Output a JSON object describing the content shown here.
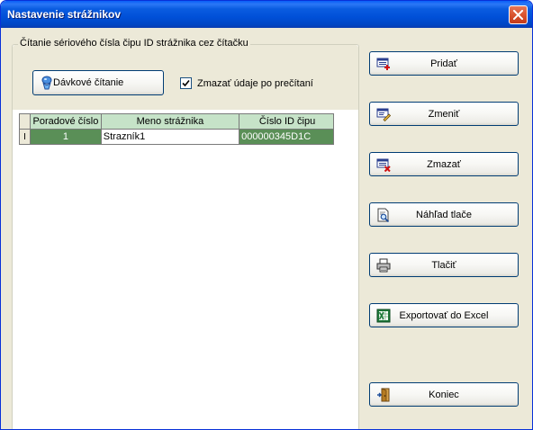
{
  "window": {
    "title": "Nastavenie strážnikov"
  },
  "group": {
    "legend": "Čítanie sériového čísla čipu ID strážnika cez čítačku",
    "batch_button": "Dávkové čítanie",
    "checkbox_label": "Zmazať údaje po prečítaní",
    "checkbox_checked": true
  },
  "table": {
    "columns": [
      "Poradové číslo",
      "Meno strážnika",
      "Číslo ID čipu"
    ],
    "rows": [
      {
        "row_marker": "I",
        "order": "1",
        "name": "Strazník1",
        "chip": "000000345D1C"
      }
    ]
  },
  "actions": {
    "add": "Pridať",
    "edit": "Zmeniť",
    "delete": "Zmazať",
    "preview": "Náhľad tlače",
    "print": "Tlačiť",
    "export": "Exportovať do Excel",
    "close": "Koniec"
  }
}
